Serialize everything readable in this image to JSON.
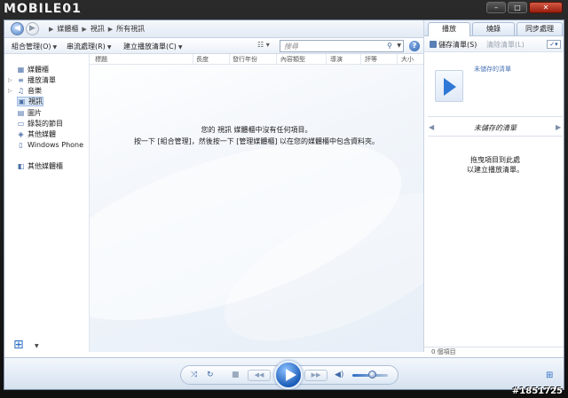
{
  "watermark": {
    "logo": "MOBILE01",
    "id": "#1851725"
  },
  "window": {
    "minimize": "–",
    "maximize": "□",
    "close": "✕"
  },
  "breadcrumbs": [
    "媒體櫃",
    "視訊",
    "所有視訊"
  ],
  "toolbar": {
    "organize": "組合管理(O)",
    "stream": "串流處理(R)",
    "create_playlist": "建立播放清單(C)",
    "search_placeholder": "搜尋"
  },
  "nav": {
    "items": [
      {
        "label": "媒體櫃",
        "icon": "library-icon"
      },
      {
        "label": "播放清單",
        "icon": "playlist-icon"
      },
      {
        "label": "音樂",
        "icon": "music-icon"
      },
      {
        "label": "視訊",
        "icon": "video-icon",
        "selected": true
      },
      {
        "label": "圖片",
        "icon": "picture-icon"
      },
      {
        "label": "錄製的節目",
        "icon": "recorded-tv-icon"
      },
      {
        "label": "其他媒體",
        "icon": "other-media-icon"
      },
      {
        "label": "Windows Phone",
        "icon": "phone-icon"
      },
      {
        "label": "其他媒體櫃",
        "icon": "other-libraries-icon"
      }
    ]
  },
  "columns": [
    "標題",
    "長度",
    "發行年份",
    "內容類型",
    "導演",
    "評等",
    "大小"
  ],
  "empty": {
    "line1": "您的 視訊 媒體櫃中沒有任何項目。",
    "line2": "按一下 [組合管理]，然後按一下 [管理媒體櫃] 以在您的媒體櫃中包含資料夾。"
  },
  "list_pane": {
    "tabs": [
      "播放",
      "燒錄",
      "同步處理"
    ],
    "active_tab": "播放",
    "save_list": "儲存清單(S)",
    "clear_list": "清除清單(L)",
    "unsaved_title": "未儲存的清單",
    "unsaved_header": "未儲存的清單",
    "drag_line1": "拖曳項目到此處",
    "drag_line2": "以建立播放清單。",
    "item_count": "0 個項目"
  },
  "colors": {
    "accent": "#2f6ec4",
    "selection": "#dbe8f8"
  }
}
